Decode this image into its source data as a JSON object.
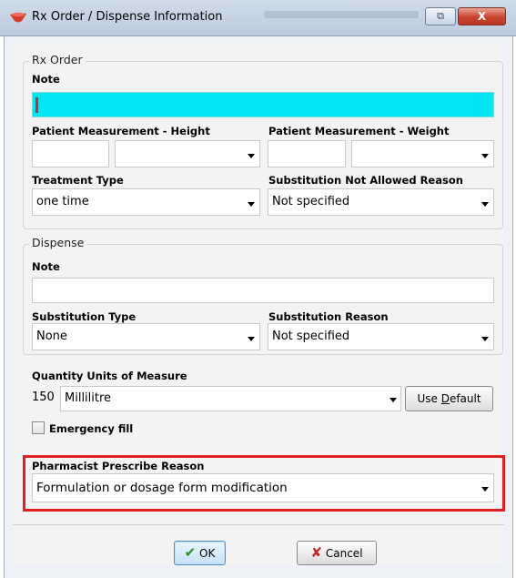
{
  "window": {
    "title": "Rx Order / Dispense Information",
    "restore_glyph": "⧉",
    "close_glyph": "X",
    "app_icon": "pill-icon"
  },
  "rx_order": {
    "legend": "Rx Order",
    "note_label": "Note",
    "note_value": "",
    "height_label": "Patient Measurement - Height",
    "height_value": "",
    "height_unit": "",
    "weight_label": "Patient Measurement - Weight",
    "weight_value": "",
    "weight_unit": "",
    "treatment_label": "Treatment Type",
    "treatment_value": "one time",
    "subst_not_allowed_label": "Substitution Not Allowed Reason",
    "subst_not_allowed_value": "Not specified"
  },
  "dispense": {
    "legend": "Dispense",
    "note_label": "Note",
    "note_value": "",
    "subst_type_label": "Substitution Type",
    "subst_type_value": "None",
    "subst_reason_label": "Substitution Reason",
    "subst_reason_value": "Not specified"
  },
  "quantity": {
    "label": "Quantity Units of Measure",
    "amount": "150",
    "unit_value": "Millilitre",
    "use_default_pre": "Use ",
    "use_default_accel": "D",
    "use_default_post": "efault"
  },
  "emergency": {
    "label": "Emergency fill",
    "checked": false
  },
  "pharmacist": {
    "label": "Pharmacist Prescribe Reason",
    "value": "Formulation or dosage form modification",
    "highlight_color": "#e02020"
  },
  "buttons": {
    "ok_label": "OK",
    "cancel_label": "Cancel"
  },
  "colors": {
    "active_note_bg": "#00e5f2",
    "ok_check": "#2e8b1e",
    "cancel_x": "#c62828"
  }
}
